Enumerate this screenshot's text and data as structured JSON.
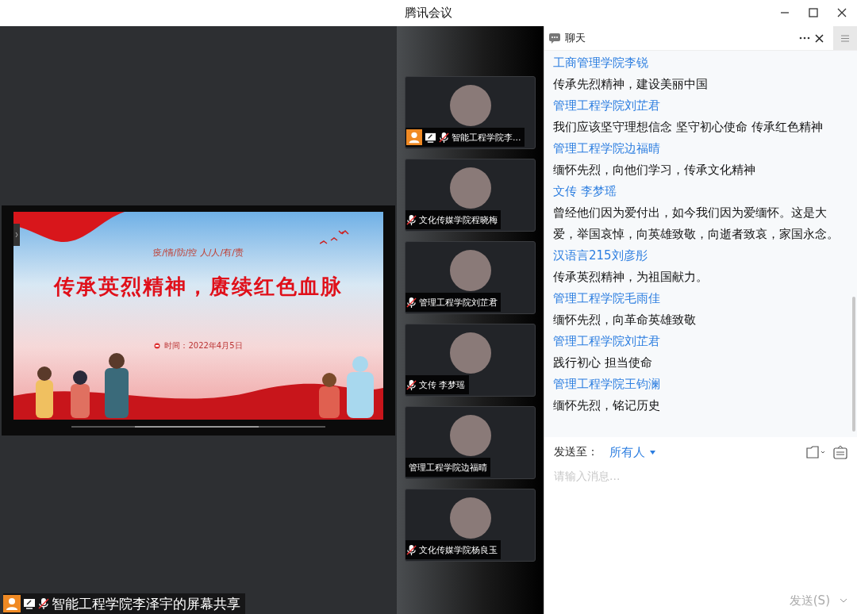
{
  "window": {
    "title": "腾讯会议"
  },
  "slide": {
    "subtitle": "疫/情/防/控 人/人/有/责",
    "title": "传承英烈精神，赓续红色血脉",
    "date": "时间：2022年4月5日"
  },
  "share_label": {
    "text": "智能工程学院李泽宇的屏幕共享",
    "host": true,
    "sharing": true,
    "muted": true
  },
  "participants": [
    {
      "name": "智能工程学院李...",
      "host": true,
      "sharing": true,
      "muted": true
    },
    {
      "name": "文化传媒学院程晓梅",
      "host": false,
      "sharing": false,
      "muted": true
    },
    {
      "name": "管理工程学院刘芷君",
      "host": false,
      "sharing": false,
      "muted": true
    },
    {
      "name": "文传 李梦瑶",
      "host": false,
      "sharing": false,
      "muted": true
    },
    {
      "name": "管理工程学院边福晴",
      "host": false,
      "sharing": false,
      "muted": false
    },
    {
      "name": "文化传媒学院杨良玉",
      "host": false,
      "sharing": false,
      "muted": true
    }
  ],
  "chat": {
    "title": "聊天",
    "messages": [
      {
        "sender": "工商管理学院李锐",
        "text": "传承先烈精神，建设美丽中国"
      },
      {
        "sender": "管理工程学院刘芷君",
        "text": "我们应该坚守理想信念 坚守初心使命 传承红色精神"
      },
      {
        "sender": "管理工程学院边福晴",
        "text": "缅怀先烈，向他们学习，传承文化精神"
      },
      {
        "sender": "文传 李梦瑶",
        "text": "曾经他们因为爱付出，如今我们因为爱缅怀。这是大爱，举国哀悼，向英雄致敬，向逝者致哀，家国永念。"
      },
      {
        "sender": "汉语言215刘彦彤",
        "text": "传承英烈精神，为祖国献力。"
      },
      {
        "sender": "管理工程学院毛雨佳",
        "text": "缅怀先烈，向革命英雄致敬"
      },
      {
        "sender": "管理工程学院刘芷君",
        "text": "践行初心 担当使命"
      },
      {
        "sender": "管理工程学院王钧澜",
        "text": "缅怀先烈，铭记历史"
      }
    ],
    "send_to_label": "发送至：",
    "recipient": "所有人",
    "input": {
      "placeholder": "请输入消息..."
    },
    "send_button": "发送(S)"
  }
}
